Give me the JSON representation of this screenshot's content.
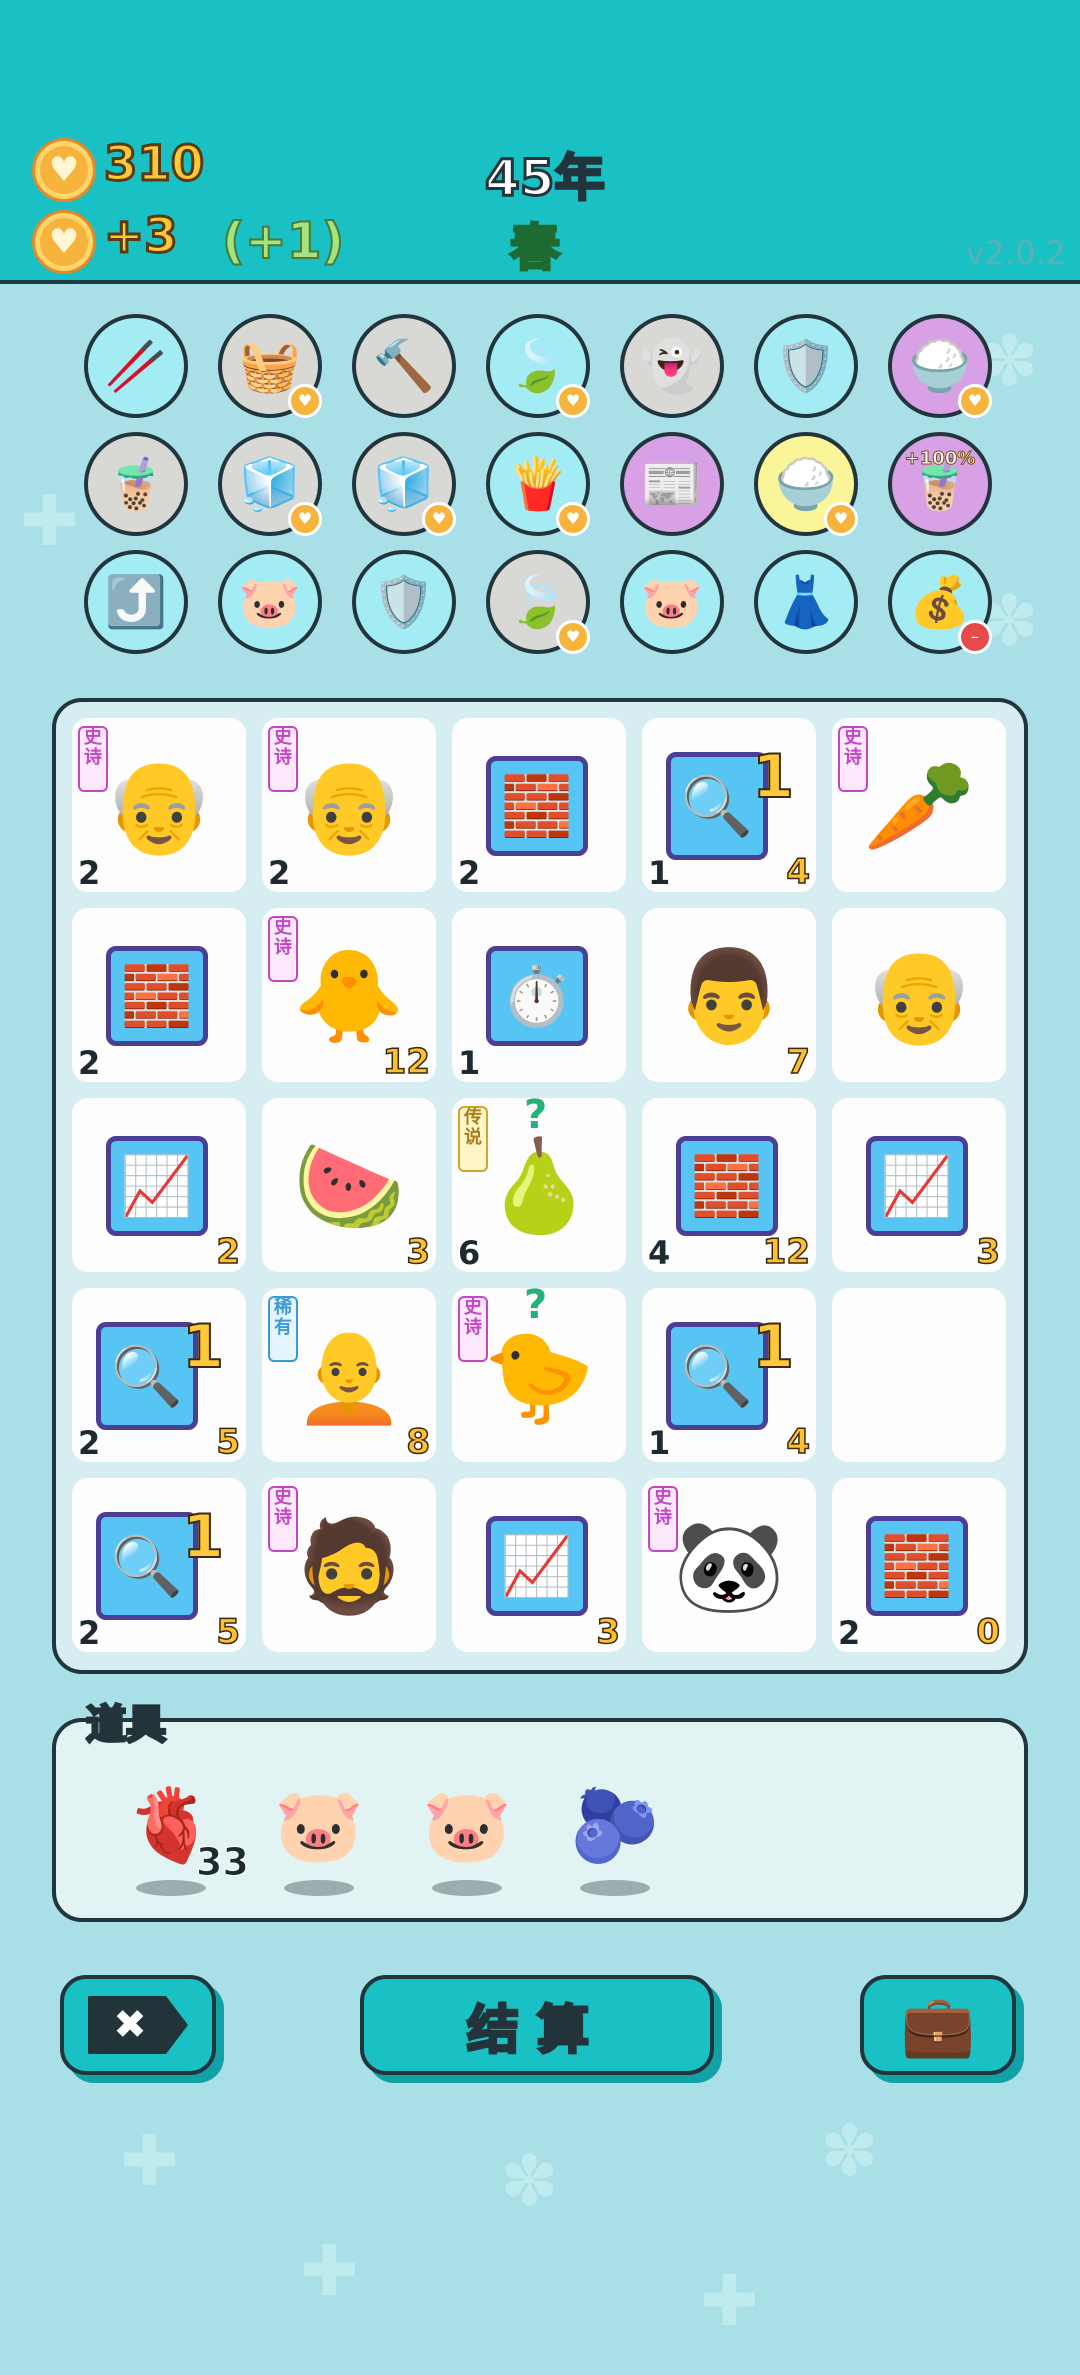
{
  "header": {
    "coins": "310",
    "income": "+3",
    "bonus": "(+1)",
    "year": "45年",
    "season": "春",
    "version": "v2.0.2"
  },
  "relics": [
    {
      "name": "sticks",
      "icon": "🥢",
      "bg": "blue"
    },
    {
      "name": "fruit-basket",
      "icon": "🧺",
      "bg": "gray",
      "badge": true
    },
    {
      "name": "hammer",
      "icon": "🔨",
      "bg": "gray"
    },
    {
      "name": "leaf",
      "icon": "🍃",
      "bg": "blue",
      "badge": true
    },
    {
      "name": "ghost",
      "icon": "👻",
      "bg": "gray"
    },
    {
      "name": "repair-shield",
      "icon": "🛡️",
      "bg": "blue"
    },
    {
      "name": "rice-bowl",
      "icon": "🍚",
      "bg": "purple",
      "badge": true
    },
    {
      "name": "bubble-tea",
      "icon": "🧋",
      "bg": "gray"
    },
    {
      "name": "sugar-cubes",
      "icon": "🧊",
      "bg": "gray",
      "badge": true
    },
    {
      "name": "sugar-cubes",
      "icon": "🧊",
      "bg": "gray",
      "badge": true
    },
    {
      "name": "fries",
      "icon": "🍟",
      "bg": "blue",
      "badge": true
    },
    {
      "name": "time-magazine",
      "icon": "📰",
      "bg": "purple"
    },
    {
      "name": "rice-bowl",
      "icon": "🍚",
      "bg": "yellow",
      "badge": true
    },
    {
      "name": "double-bubble-tea",
      "icon": "🧋",
      "bg": "purple",
      "text": "+100%"
    },
    {
      "name": "up-arrow-card",
      "icon": "⤴️",
      "bg": "blue"
    },
    {
      "name": "piggy-bank",
      "icon": "🐷",
      "bg": "blue"
    },
    {
      "name": "repair-shield",
      "icon": "🛡️",
      "bg": "blue"
    },
    {
      "name": "leaf",
      "icon": "🍃",
      "bg": "gray",
      "badge": true
    },
    {
      "name": "piggy-bank",
      "icon": "🐷",
      "bg": "blue"
    },
    {
      "name": "skirt",
      "icon": "👗",
      "bg": "blue"
    },
    {
      "name": "money-bag",
      "icon": "💰",
      "bg": "blue",
      "badge": "red"
    }
  ],
  "board": [
    {
      "name": "grandpa",
      "icon": "👴",
      "tag": "史诗",
      "tagType": "purple",
      "left": "2",
      "right": ""
    },
    {
      "name": "grandpa",
      "icon": "👴",
      "tag": "史诗",
      "tagType": "purple",
      "left": "2",
      "right": ""
    },
    {
      "name": "gold-bars",
      "icon": "🧱",
      "panel": true,
      "left": "2",
      "right": ""
    },
    {
      "name": "coin-magnifier",
      "icon": "🔍",
      "panel": true,
      "big": "1",
      "left": "1",
      "right": "4"
    },
    {
      "name": "carrot",
      "icon": "🥕",
      "tag": "史诗",
      "tagType": "purple",
      "left": "",
      "right": ""
    },
    {
      "name": "gold-bars",
      "icon": "🧱",
      "panel": true,
      "left": "2",
      "right": ""
    },
    {
      "name": "chick",
      "icon": "🐥",
      "tag": "史诗",
      "tagType": "purple",
      "left": "",
      "right": "12"
    },
    {
      "name": "stopwatch",
      "icon": "⏱️",
      "panel": true,
      "left": "1",
      "right": ""
    },
    {
      "name": "man",
      "icon": "👨",
      "left": "",
      "right": "7"
    },
    {
      "name": "old-man",
      "icon": "👴",
      "left": "",
      "right": ""
    },
    {
      "name": "growth-chart",
      "icon": "📈",
      "panel": true,
      "left": "",
      "right": "2"
    },
    {
      "name": "watermelon-ball",
      "icon": "🍉",
      "left": "",
      "right": "3"
    },
    {
      "name": "pear",
      "icon": "🍐",
      "tag": "传说",
      "tagType": "gold",
      "question": true,
      "left": "6",
      "right": ""
    },
    {
      "name": "gold-bars",
      "icon": "🧱",
      "panel": true,
      "left": "4",
      "right": "12"
    },
    {
      "name": "growth-chart",
      "icon": "📈",
      "panel": true,
      "left": "",
      "right": "3"
    },
    {
      "name": "coin-magnifier",
      "icon": "🔍",
      "panel": true,
      "big": "1",
      "left": "2",
      "right": "5"
    },
    {
      "name": "bald-man",
      "icon": "🧑‍🦲",
      "tag": "稀有",
      "tagType": "blue",
      "left": "",
      "right": "8"
    },
    {
      "name": "einstein-chick",
      "icon": "🐤",
      "tag": "史诗",
      "tagType": "purple",
      "question": true,
      "left": "",
      "right": ""
    },
    {
      "name": "coin-magnifier",
      "icon": "🔍",
      "panel": true,
      "big": "1",
      "left": "1",
      "right": "4"
    },
    {
      "name": "empty",
      "icon": "",
      "left": "",
      "right": ""
    },
    {
      "name": "coin-magnifier",
      "icon": "🔍",
      "panel": true,
      "big": "1",
      "left": "2",
      "right": "5"
    },
    {
      "name": "bearded-man",
      "icon": "🧔",
      "tag": "史诗",
      "tagType": "purple",
      "left": "",
      "right": ""
    },
    {
      "name": "growth-chart",
      "icon": "📈",
      "panel": true,
      "left": "",
      "right": "3"
    },
    {
      "name": "panda",
      "icon": "🐼",
      "tag": "史诗",
      "tagType": "purple",
      "left": "",
      "right": ""
    },
    {
      "name": "gold-bars",
      "icon": "🧱",
      "panel": true,
      "left": "2",
      "right": "0"
    }
  ],
  "inventory": {
    "title": "道具",
    "items": [
      {
        "name": "liver",
        "icon": "🫀",
        "count": "33"
      },
      {
        "name": "piggy-bank",
        "icon": "🐷"
      },
      {
        "name": "piggy-bank",
        "icon": "🐷"
      },
      {
        "name": "blueberry",
        "icon": "🫐"
      }
    ]
  },
  "buttons": {
    "settle": "结算",
    "delete_icon": "✖",
    "bag_icon": "💼"
  }
}
